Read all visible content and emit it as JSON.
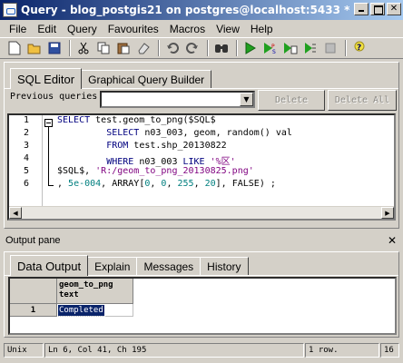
{
  "window": {
    "title": "Query - blog_postgis21 on postgres@localhost:5433 *",
    "icon": "pgadmin-query-icon"
  },
  "menu": [
    "File",
    "Edit",
    "Query",
    "Favourites",
    "Macros",
    "View",
    "Help"
  ],
  "toolbar": {
    "icons": [
      "new-icon",
      "open-icon",
      "save-icon",
      "cut-icon",
      "copy-icon",
      "paste-icon",
      "clear-icon",
      "undo-icon",
      "redo-icon",
      "find-icon",
      "execute-icon",
      "execute-pgscript-icon",
      "execute-to-file-icon",
      "explain-icon",
      "cancel-icon",
      "help-icon"
    ]
  },
  "sql_panel": {
    "tabs": [
      {
        "label": "SQL Editor",
        "active": true
      },
      {
        "label": "Graphical Query Builder",
        "active": false
      }
    ],
    "previous_queries_label": "Previous queries",
    "previous_queries_value": "",
    "delete_label": "Delete",
    "delete_all_label": "Delete All",
    "line_numbers": [
      "1",
      "2",
      "3",
      "4",
      "5",
      "6"
    ],
    "code_lines": [
      [
        {
          "t": "SELECT",
          "c": "kw"
        },
        {
          "t": " test.geom_to_png($SQL$"
        }
      ],
      [
        {
          "t": "         "
        },
        {
          "t": "SELECT",
          "c": "kw"
        },
        {
          "t": " n03_003, geom, random() val"
        }
      ],
      [
        {
          "t": "         "
        },
        {
          "t": "FROM",
          "c": "kw"
        },
        {
          "t": " test.shp_20130822"
        }
      ],
      [
        {
          "t": "         "
        },
        {
          "t": "WHERE",
          "c": "kw"
        },
        {
          "t": " n03_003 "
        },
        {
          "t": "LIKE",
          "c": "kw"
        },
        {
          "t": " '%区'",
          "c": "str"
        }
      ],
      [
        {
          "t": "$SQL$, "
        },
        {
          "t": "'R:/geom_to_png_20130825.png'",
          "c": "str"
        }
      ],
      [
        {
          "t": ", "
        },
        {
          "t": "5e-004",
          "c": "num"
        },
        {
          "t": ", ARRAY["
        },
        {
          "t": "0",
          "c": "num"
        },
        {
          "t": ", "
        },
        {
          "t": "0",
          "c": "num"
        },
        {
          "t": ", "
        },
        {
          "t": "255",
          "c": "num"
        },
        {
          "t": ", "
        },
        {
          "t": "20",
          "c": "num"
        },
        {
          "t": "], FALSE) ;"
        }
      ]
    ]
  },
  "output": {
    "pane_title": "Output pane",
    "tabs": [
      {
        "label": "Data Output",
        "active": true
      },
      {
        "label": "Explain",
        "active": false
      },
      {
        "label": "Messages",
        "active": false
      },
      {
        "label": "History",
        "active": false
      }
    ],
    "column_name": "geom_to_png",
    "column_type": "text",
    "rows": [
      {
        "num": "1",
        "value": "Completed"
      }
    ]
  },
  "status": {
    "encoding": "Unix",
    "position": "Ln 6, Col 41, Ch 195",
    "rows": "1 row.",
    "time": "16"
  },
  "colors": {
    "title_gradient_start": "#0a246a",
    "title_gradient_end": "#a6caf0",
    "keyword": "#00007f",
    "string": "#7f007f",
    "number": "#007f7f",
    "selection": "#0a246a"
  }
}
